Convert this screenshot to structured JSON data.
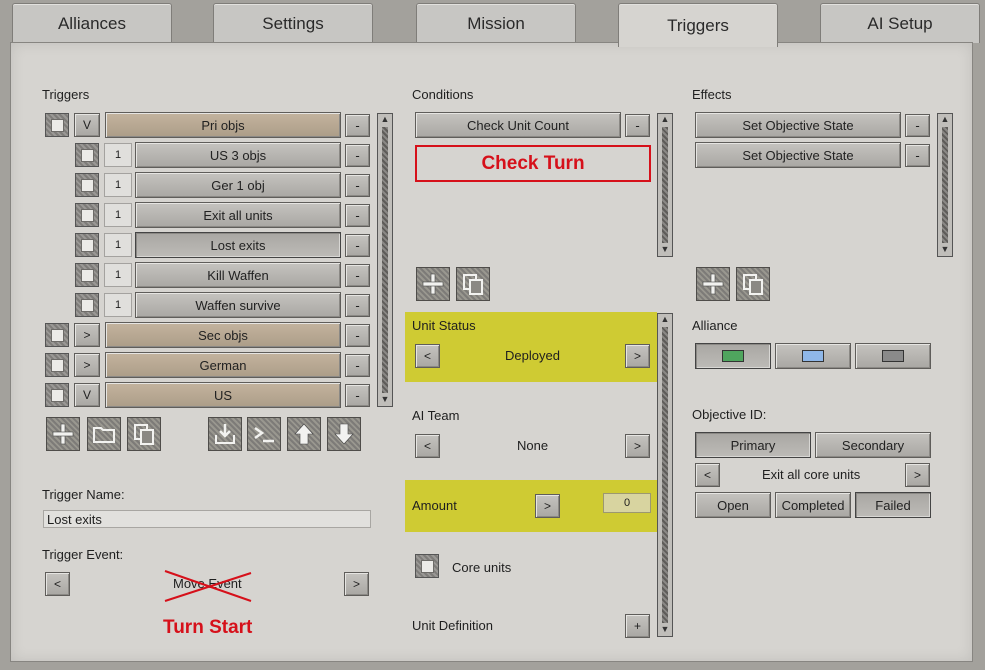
{
  "tabs": [
    {
      "label": "Alliances"
    },
    {
      "label": "Settings"
    },
    {
      "label": "Mission"
    },
    {
      "label": "Triggers"
    },
    {
      "label": "AI Setup"
    }
  ],
  "triggers": {
    "heading": "Triggers",
    "items": [
      {
        "toggle": "V",
        "label": "Pri objs"
      },
      {
        "num": "1",
        "label": "US 3 objs"
      },
      {
        "num": "1",
        "label": "Ger 1 obj"
      },
      {
        "num": "1",
        "label": "Exit all units"
      },
      {
        "num": "1",
        "label": "Lost exits"
      },
      {
        "num": "1",
        "label": "Kill Waffen"
      },
      {
        "num": "1",
        "label": "Waffen survive"
      },
      {
        "toggle": ">",
        "label": "Sec objs"
      },
      {
        "toggle": ">",
        "label": "German"
      },
      {
        "toggle": "V",
        "label": "US"
      }
    ],
    "remove_label": "-"
  },
  "trigger_name": {
    "label": "Trigger Name:",
    "value": "Lost exits"
  },
  "trigger_event": {
    "label": "Trigger Event:",
    "prev": "<",
    "value": "Move Event",
    "next": ">"
  },
  "annotations": {
    "check_turn": "Check Turn",
    "turn_start": "Turn Start"
  },
  "conditions": {
    "heading": "Conditions",
    "items": [
      {
        "label": "Check Unit Count"
      }
    ],
    "remove_label": "-",
    "unit_status": {
      "label": "Unit Status",
      "prev": "<",
      "value": "Deployed",
      "next": ">"
    },
    "ai_team": {
      "label": "AI Team",
      "prev": "<",
      "value": "None",
      "next": ">"
    },
    "amount": {
      "label": "Amount",
      "btn": ">",
      "value": "0"
    },
    "core_units": {
      "label": "Core units"
    },
    "unit_definition": {
      "label": "Unit Definition",
      "btn": "+"
    }
  },
  "effects": {
    "heading": "Effects",
    "items": [
      {
        "label": "Set Objective State"
      },
      {
        "label": "Set Objective State"
      }
    ],
    "remove_label": "-",
    "alliance": {
      "label": "Alliance"
    },
    "objective": {
      "label": "Objective ID:",
      "primary": "Primary",
      "secondary": "Secondary",
      "prev": "<",
      "value": "Exit all core units",
      "next": ">",
      "open": "Open",
      "completed": "Completed",
      "failed": "Failed"
    }
  },
  "colors": {
    "alliance_green": "#4fa55e",
    "alliance_blue": "#8fb7e8",
    "alliance_grey": "#8a8a8a",
    "highlight": "#cfcb33",
    "annotation_red": "#d6101a"
  }
}
